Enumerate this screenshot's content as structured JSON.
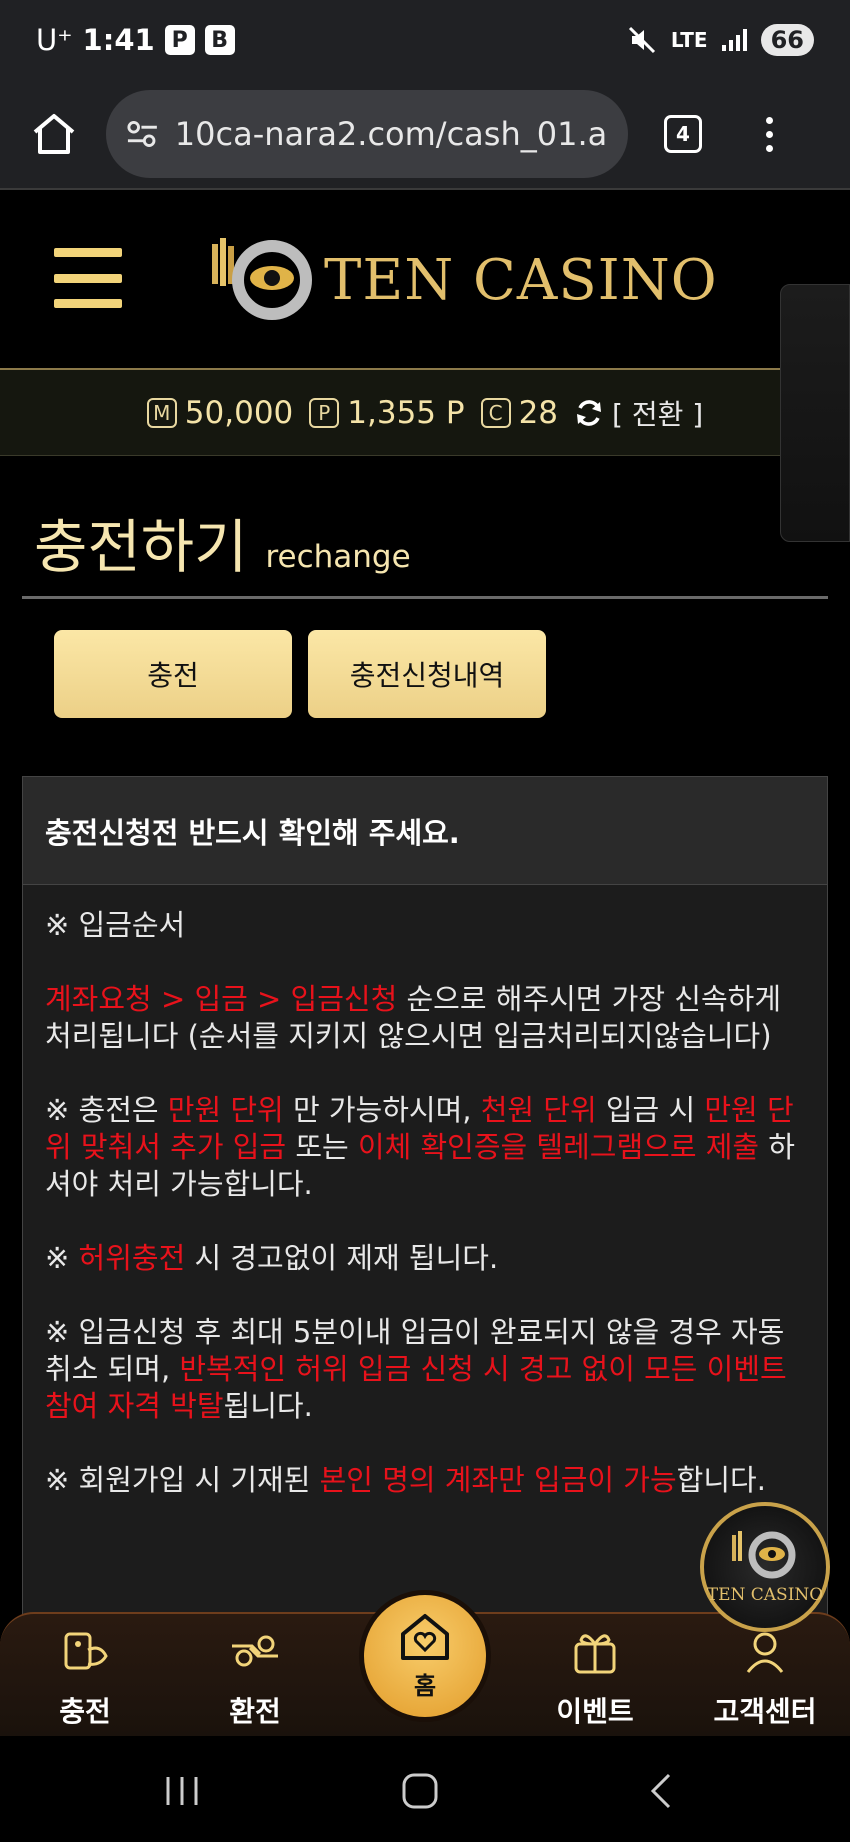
{
  "status_bar": {
    "carrier": "U⁺",
    "time": "1:41",
    "icon_p": "P",
    "icon_b": "B",
    "network": "LTE",
    "battery": "66"
  },
  "browser": {
    "url": "10ca-nara2.com/cash_01.as",
    "tab_count": "4"
  },
  "header": {
    "logo_text": "TEN CASINO"
  },
  "balance": {
    "money_badge": "M",
    "money": "50,000",
    "point_badge": "P",
    "points": "1,355 P",
    "comp_badge": "C",
    "comp": "28",
    "switch_label": "[ 전환 ]"
  },
  "page": {
    "title": "충전하기",
    "subtitle": "rechange"
  },
  "tabs": {
    "charge": "충전",
    "history": "충전신청내역"
  },
  "notice": {
    "heading": "충전신청전 반드시 확인해 주세요.",
    "p1": "※ 입금순서",
    "p2_red": "계좌요청 > 입금 > 입금신청",
    "p2_rest": " 순으로 해주시면 가장 신속하게 처리됩니다 (순서를 지키지 않으시면 입금처리되지않습니다)",
    "p3_a": "※ 충전은 ",
    "p3_red1": "만원 단위",
    "p3_b": " 만 가능하시며, ",
    "p3_red2": "천원 단위",
    "p3_c": " 입금 시 ",
    "p3_red3": "만원 단위 맞춰서 추가 입금",
    "p3_d": " 또는 ",
    "p3_red4": "이체 확인증을 텔레그램으로 제출",
    "p3_e": " 하셔야 처리 가능합니다.",
    "p4_a": "※ ",
    "p4_red": "허위충전",
    "p4_b": " 시 경고없이 제재 됩니다.",
    "p5_a": "※ 입금신청 후 최대 5분이내 입금이 완료되지 않을 경우 자동 취소 되며, ",
    "p5_red": "반복적인 허위 입금 신청 시 경고 없이 모든 이벤트 참여 자격 박탈",
    "p5_b": "됩니다.",
    "p6_a": "※ 회원가입 시 기재된 ",
    "p6_red": "본인 명의 계좌만 입금이 가능",
    "p6_b": "합니다."
  },
  "bottom_nav": {
    "charge": "충전",
    "exchange": "환전",
    "home": "홈",
    "event": "이벤트",
    "support": "고객센터"
  },
  "floating_logo_text": "TEN CASINO",
  "colors": {
    "gold": "#f6e6b0",
    "red": "#e8121b",
    "button": "#fbe7a6"
  }
}
